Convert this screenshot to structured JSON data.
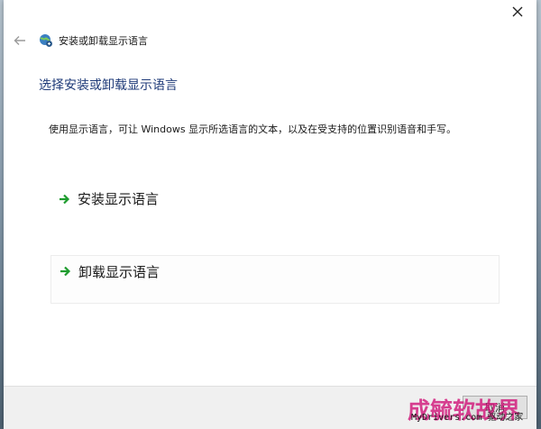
{
  "window": {
    "title": "安装或卸载显示语言"
  },
  "page": {
    "heading": "选择安装或卸载显示语言",
    "description": "使用显示语言，可让 Windows 显示所选语言的文本，以及在受支持的位置识别语音和手写。"
  },
  "options": [
    {
      "label": "安装显示语言",
      "icon": "green-arrow-icon"
    },
    {
      "label": "卸载显示语言",
      "icon": "green-arrow-icon"
    }
  ],
  "footer": {
    "cancel_label": "取消"
  },
  "watermark": {
    "big": "成毓软故界",
    "small": "MyDrivers.com 驱动之家"
  },
  "colors": {
    "heading": "#1e3a78",
    "arrow": "#1e9c2e",
    "footer_bg": "#f0f0f0"
  }
}
